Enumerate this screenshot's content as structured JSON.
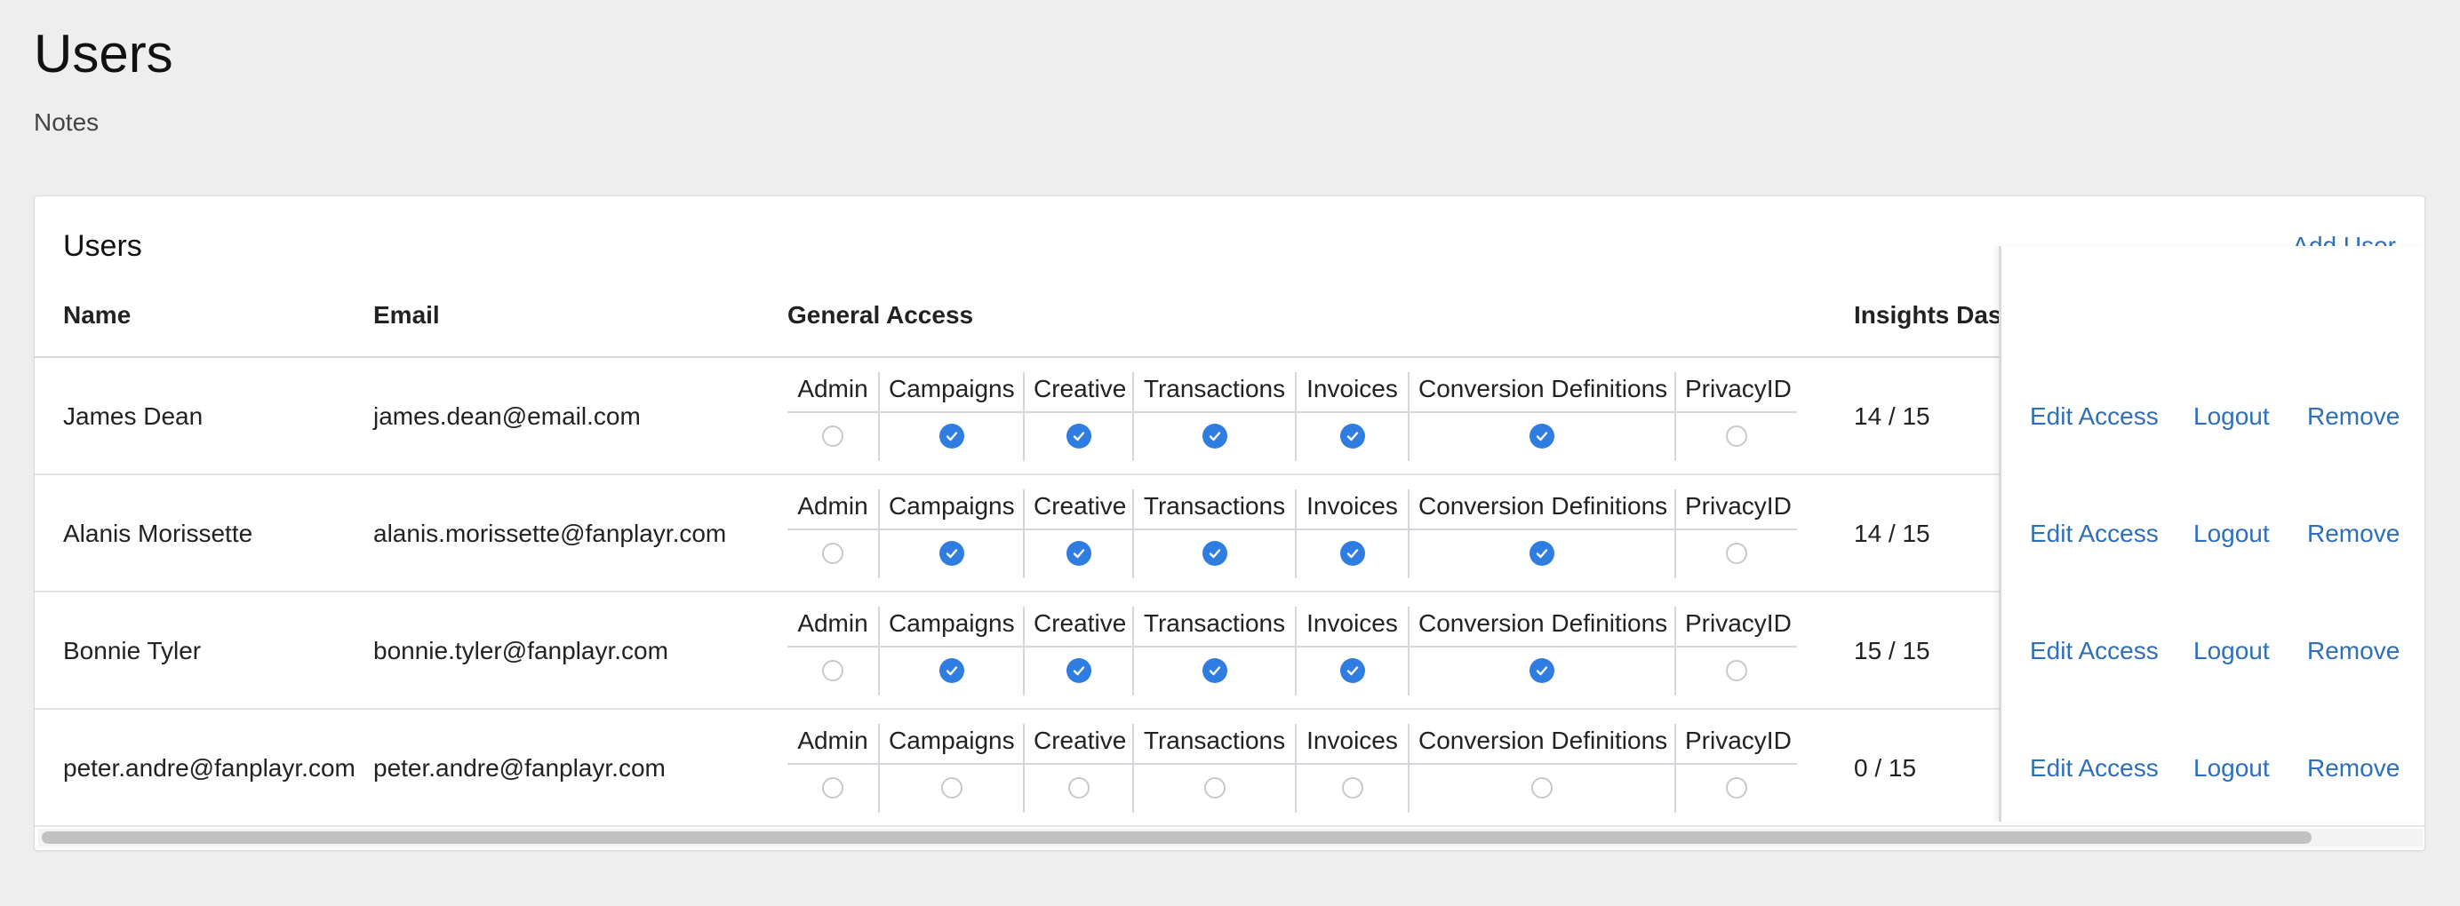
{
  "page": {
    "title": "Users",
    "notes": "Notes"
  },
  "card": {
    "title": "Users",
    "add_user_label": "Add User"
  },
  "columns": {
    "name": "Name",
    "email": "Email",
    "general_access": "General Access",
    "insights": "Insights Dasl"
  },
  "permission_labels": [
    "Admin",
    "Campaigns",
    "Creative",
    "Transactions",
    "Invoices",
    "Conversion Definitions",
    "PrivacyID"
  ],
  "actions": {
    "edit": "Edit Access",
    "logout": "Logout",
    "remove": "Remove"
  },
  "colors": {
    "accent": "#2f7de1",
    "link": "#2f6fb7"
  },
  "users": [
    {
      "name": "James Dean",
      "email": "james.dean@email.com",
      "permissions": [
        false,
        true,
        true,
        true,
        true,
        true,
        false
      ],
      "insights": "14 / 15"
    },
    {
      "name": "Alanis Morissette",
      "email": "alanis.morissette@fanplayr.com",
      "permissions": [
        false,
        true,
        true,
        true,
        true,
        true,
        false
      ],
      "insights": "14 / 15"
    },
    {
      "name": "Bonnie Tyler",
      "email": "bonnie.tyler@fanplayr.com",
      "permissions": [
        false,
        true,
        true,
        true,
        true,
        true,
        false
      ],
      "insights": "15 / 15"
    },
    {
      "name": "peter.andre@fanplayr.com",
      "email": "peter.andre@fanplayr.com",
      "permissions": [
        false,
        false,
        false,
        false,
        false,
        false,
        false
      ],
      "insights": "0 / 15"
    }
  ]
}
